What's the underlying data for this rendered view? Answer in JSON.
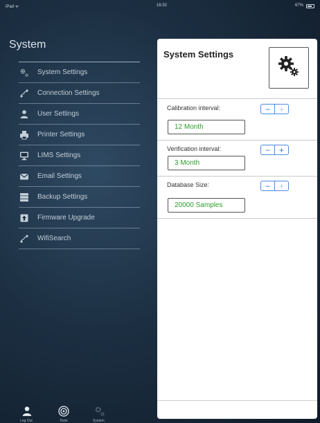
{
  "status_bar": {
    "device": "iPad ᯤ",
    "time": "16:32",
    "battery": "67%"
  },
  "sidebar": {
    "title": "System",
    "items": [
      {
        "label": "System Settings",
        "icon": "gears-icon"
      },
      {
        "label": "Connection Settings",
        "icon": "connection-icon"
      },
      {
        "label": "User Settings",
        "icon": "user-icon"
      },
      {
        "label": "Printer Settings",
        "icon": "printer-icon"
      },
      {
        "label": "LIMS Settings",
        "icon": "monitor-icon"
      },
      {
        "label": "Email Settings",
        "icon": "email-icon"
      },
      {
        "label": "Backup Settings",
        "icon": "database-icon"
      },
      {
        "label": "Firmware Upgrade",
        "icon": "upload-icon"
      },
      {
        "label": "WifiSearch",
        "icon": "connection-icon"
      }
    ]
  },
  "tabbar": {
    "tabs": [
      {
        "label": "Log Out",
        "icon": "user-icon"
      },
      {
        "label": "Tests",
        "icon": "target-icon"
      },
      {
        "label": "System",
        "icon": "gears-icon"
      }
    ]
  },
  "panel": {
    "title": "System Settings",
    "settings": [
      {
        "label": "Calibration interval:",
        "value": "12  Month"
      },
      {
        "label": "Verification interval:",
        "value": "3  Month"
      },
      {
        "label": "Database Size:",
        "value": "20000  Samples"
      }
    ],
    "stepper": {
      "minus": "−",
      "plus": "+"
    }
  }
}
